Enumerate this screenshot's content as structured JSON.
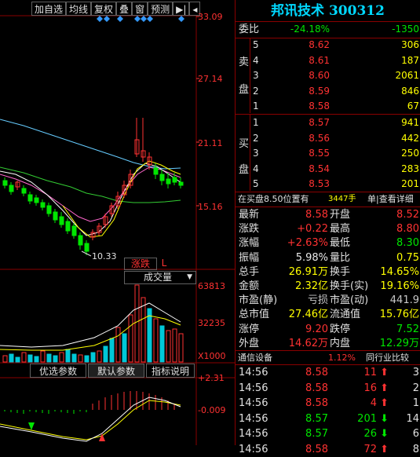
{
  "toolbar": {
    "buttons": [
      "加自选",
      "均线",
      "复权",
      "叠",
      "窗",
      "预测",
      "▶|",
      "◂"
    ]
  },
  "chart": {
    "price_axis": [
      "33.09",
      "27.14",
      "21.11",
      "15.16"
    ],
    "low_label": "10.33",
    "tab_rise": "涨跌",
    "tab_l": "L",
    "volume_dropdown": "成交量",
    "volume_axis": [
      "63813",
      "32235",
      "X1000"
    ],
    "tabs": [
      "优选参数",
      "默认参数",
      "指标说明"
    ],
    "macd_axis": [
      "+2.31",
      "-0.009"
    ]
  },
  "stock": {
    "title": "邦讯技术 300312",
    "weibi_label": "委比",
    "weibi_pct": "-24.18%",
    "weibi_val": "-1350",
    "sell_chars": [
      "卖",
      "盘"
    ],
    "buy_chars": [
      "买",
      "盘"
    ],
    "sell": [
      {
        "lvl": "5",
        "price": "8.62",
        "vol": "306"
      },
      {
        "lvl": "4",
        "price": "8.61",
        "vol": "187"
      },
      {
        "lvl": "3",
        "price": "8.60",
        "vol": "2061"
      },
      {
        "lvl": "2",
        "price": "8.59",
        "vol": "846"
      },
      {
        "lvl": "1",
        "price": "8.58",
        "vol": "67"
      }
    ],
    "buy": [
      {
        "lvl": "1",
        "price": "8.57",
        "vol": "941"
      },
      {
        "lvl": "2",
        "price": "8.56",
        "vol": "442"
      },
      {
        "lvl": "3",
        "price": "8.55",
        "vol": "250"
      },
      {
        "lvl": "4",
        "price": "8.54",
        "vol": "283"
      },
      {
        "lvl": "5",
        "price": "8.53",
        "vol": "201"
      }
    ],
    "notice_a": "在买盘8.50位置有",
    "notice_b": "3447手",
    "notice_c": "单|查看详细",
    "stats": [
      {
        "l1": "最新",
        "v1": "8.58",
        "c1": "red",
        "l2": "开盘",
        "v2": "8.52",
        "c2": "red"
      },
      {
        "l1": "涨跌",
        "v1": "+0.22",
        "c1": "red",
        "l2": "最高",
        "v2": "8.80",
        "c2": "red"
      },
      {
        "l1": "涨幅",
        "v1": "+2.63%",
        "c1": "red",
        "l2": "最低",
        "v2": "8.30",
        "c2": "green"
      },
      {
        "l1": "振幅",
        "v1": "5.98%",
        "c1": "white",
        "l2": "量比",
        "v2": "0.75",
        "c2": "yellow"
      },
      {
        "l1": "总手",
        "v1": "26.91万",
        "c1": "yellow",
        "l2": "换手",
        "v2": "14.65%",
        "c2": "yellow"
      },
      {
        "l1": "金额",
        "v1": "2.32亿",
        "c1": "yellow",
        "l2": "换手(实)",
        "v2": "19.16%",
        "c2": "yellow"
      },
      {
        "l1": "市盈(静)",
        "v1": "亏损",
        "c1": "gray",
        "l2": "市盈(动)",
        "v2": "441.9",
        "c2": "gray"
      },
      {
        "l1": "总市值",
        "v1": "27.46亿",
        "c1": "yellow",
        "l2": "流通值",
        "v2": "15.76亿",
        "c2": "yellow"
      },
      {
        "l1": "涨停",
        "v1": "9.20",
        "c1": "red",
        "l2": "跌停",
        "v2": "7.52",
        "c2": "green"
      },
      {
        "l1": "外盘",
        "v1": "14.62万",
        "c1": "red",
        "l2": "内盘",
        "v2": "12.29万",
        "c2": "green"
      }
    ],
    "industry_label": "通信设备",
    "industry_pct": "1.12%",
    "industry_link": "同行业比较",
    "ticks": [
      {
        "time": "14:56",
        "price": "8.58",
        "vol": "11",
        "dir": "up",
        "last": "3"
      },
      {
        "time": "14:56",
        "price": "8.58",
        "vol": "16",
        "dir": "up",
        "last": "2"
      },
      {
        "time": "14:56",
        "price": "8.58",
        "vol": "4",
        "dir": "up",
        "last": "1"
      },
      {
        "time": "14:56",
        "price": "8.57",
        "vol": "201",
        "dir": "down",
        "last": "14"
      },
      {
        "time": "14:56",
        "price": "8.57",
        "vol": "26",
        "dir": "down",
        "last": "6"
      },
      {
        "time": "14:56",
        "price": "8.58",
        "vol": "72",
        "dir": "up",
        "last": "8"
      }
    ]
  },
  "colors": {
    "up": "#ff3232",
    "down": "#00e600",
    "grid": "#8a0000",
    "title": "#00d8ff"
  }
}
